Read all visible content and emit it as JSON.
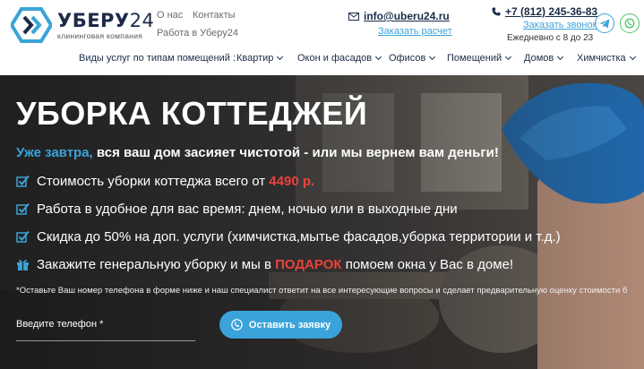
{
  "brand": {
    "name_main": "УБЕРУ",
    "name_accent": "24",
    "tagline": "клининговая компания",
    "accent_color": "#3aa3d9",
    "dark_color": "#1b2b49"
  },
  "toplinks": [
    {
      "label": "О нас"
    },
    {
      "label": "Контакты"
    },
    {
      "label": "Работа в Уберу24"
    }
  ],
  "contact": {
    "email_icon": "envelope-icon",
    "email": "info@uberu24.ru",
    "calc_link": "Заказать расчет",
    "phone_icon": "phone-icon",
    "phone": "+7 (812) 245-36-83",
    "callback_link": "Заказать звонок",
    "hours": "Ежедневно с 8 до 23"
  },
  "social": [
    {
      "icon": "telegram-icon",
      "color": "#3aa3d9"
    },
    {
      "icon": "whatsapp-icon",
      "color": "#4cc763"
    }
  ],
  "nav": {
    "label": "Виды услуг по типам помещений :",
    "items": [
      {
        "label": "Квартир"
      },
      {
        "label": "Окон и фасадов"
      },
      {
        "label": "Офисов"
      },
      {
        "label": "Помещений"
      },
      {
        "label": "Домов"
      },
      {
        "label": "Химчистка"
      }
    ]
  },
  "hero": {
    "title": "УБОРКА КОТТЕДЖЕЙ",
    "subtitle_accent": "Уже завтра,",
    "subtitle_rest": " вся ваш дом засияет чистотой - или мы вернем вам деньги!",
    "features": {
      "f1_text": "Стоимость уборки коттеджа всего от ",
      "f1_price": "4490 р.",
      "f2_text": "Работа в удобное для вас время: днем, ночью или в выходные дни",
      "f3_text": "Скидка до 50% на доп. услуги (химчистка,мытье фасадов,уборка территории и т.д.)",
      "f4_before": "Закажите генеральную уборку и мы в ",
      "f4_highlight": "ПОДАРОК",
      "f4_after": " помоем окна у Вас в доме!"
    },
    "note": "*Оставьте Ваш номер телефона в форме ниже и наш специалист ответит на все интересующие вопросы и сделает предварительную оценку стоимости б",
    "phone_label": "Введите телефон *",
    "submit_label": "Оставить заявку",
    "highlight_color": "#e8433c"
  }
}
